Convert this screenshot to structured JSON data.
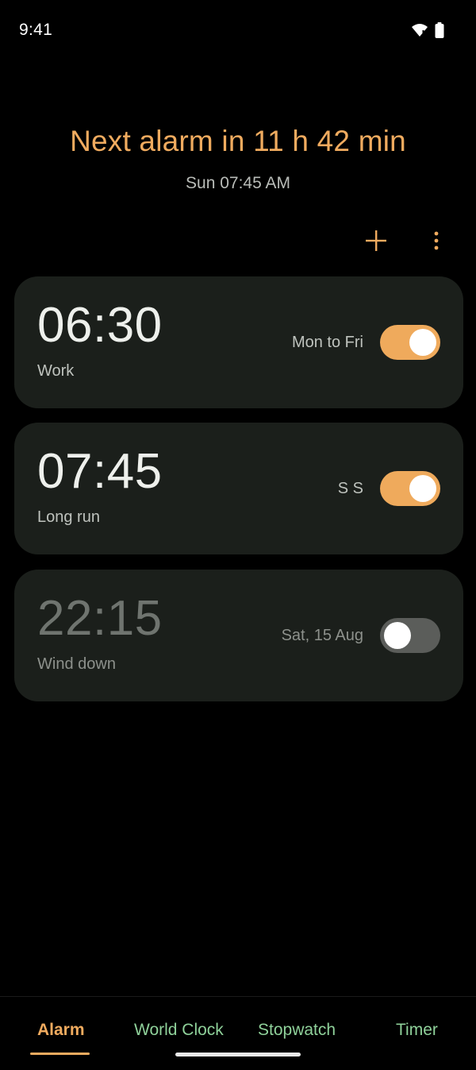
{
  "status_bar": {
    "time": "9:41",
    "icons": [
      "wifi-icon",
      "battery-icon"
    ]
  },
  "header": {
    "next_alarm": "Next alarm in 11 h 42 min",
    "next_alarm_time": "Sun 07:45 AM"
  },
  "toolbar": {
    "add_icon": "plus-icon",
    "more_icon": "more-vertical-icon"
  },
  "alarms": [
    {
      "time": "06:30",
      "label": "Work",
      "days": "Mon to Fri",
      "enabled": true
    },
    {
      "time": "07:45",
      "label": "Long run",
      "days": "S S",
      "enabled": true
    },
    {
      "time": "22:15",
      "label": "Wind down",
      "days": "Sat, 15 Aug",
      "enabled": false
    }
  ],
  "bottom_nav": {
    "tabs": [
      {
        "label": "Alarm",
        "active": true
      },
      {
        "label": "World Clock",
        "active": false
      },
      {
        "label": "Stopwatch",
        "active": false
      },
      {
        "label": "Timer",
        "active": false
      }
    ]
  },
  "colors": {
    "accent": "#f0ab5f",
    "tab_inactive": "#8fd19a",
    "card_background": "#1b1f1b",
    "toggle_off": "#5b5d5a"
  }
}
